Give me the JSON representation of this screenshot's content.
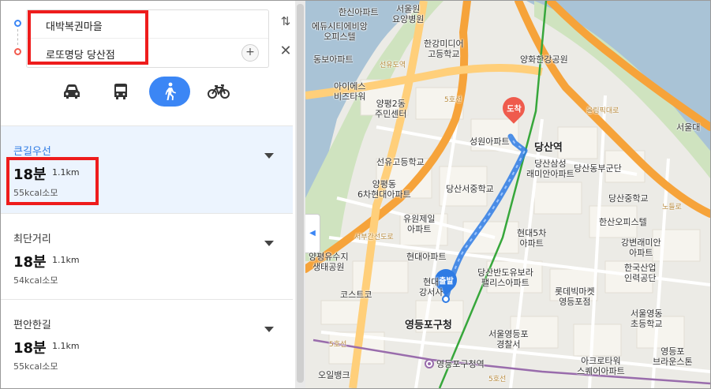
{
  "origin": {
    "text": "대박복권마을"
  },
  "destination": {
    "text": "로또명당 당산점"
  },
  "controls": {
    "add_stop": "+",
    "swap": "⇅",
    "close": "✕"
  },
  "modes": [
    {
      "name": "car",
      "icon": "car-icon"
    },
    {
      "name": "bus",
      "icon": "bus-icon"
    },
    {
      "name": "walk",
      "icon": "walk-icon",
      "selected": true
    },
    {
      "name": "bike",
      "icon": "bike-icon"
    }
  ],
  "routes": [
    {
      "type": "큰길우선",
      "time": "18분",
      "distance": "1.1km",
      "kcal": "55kcal소모",
      "active": true
    },
    {
      "type": "최단거리",
      "time": "18분",
      "distance": "1.1km",
      "kcal": "54kcal소모",
      "active": false
    },
    {
      "type": "편안한길",
      "time": "18분",
      "distance": "1.1km",
      "kcal": "55kcal소모",
      "active": false
    }
  ],
  "map": {
    "collapse": "◀",
    "start_pin": "출발",
    "end_pin": "도착",
    "labels": {
      "l1": "한신아파트",
      "l2": "서울원\n요양병원",
      "l3": "에듀시티에비앙\n오피스텔",
      "l4": "한강미디어\n고등학교",
      "l5": "동보아파트",
      "l6": "양화한강공원",
      "l7": "아이에스\n비즈타워",
      "l8": "양평2동\n주민센터",
      "l9": "성원아파트",
      "l10": "당산역",
      "l11": "당산삼성\n래미안아파트",
      "l12": "당산동부군단",
      "l13": "선유고등학교",
      "l14": "양평동\n6차현대아파트",
      "l15": "당산서중학교",
      "l16": "당산중학교",
      "l17": "유원제일\n아파트",
      "l18": "현대5차\n아파트",
      "l19": "한산오피스텔",
      "l20": "강변래미안\n아파트",
      "l21": "현대아파트",
      "l22": "양평유수지\n생태공원",
      "l23": "당산반도유보라\n팰리스아파트",
      "l24": "한국산업\n인력공단",
      "l25": "현대\n강서사",
      "l26": "코스트코",
      "l27": "롯데빅마켓\n영등포점",
      "l28": "서울영동\n초등학교",
      "l29": "영등포구청",
      "l30": "서울영등포\n경찰서",
      "l31": "영등포구청역",
      "l32": "오일뱅크",
      "l33": "아크로타워\n스퀘어아파트",
      "l34": "영등포\n브라운스톤",
      "l35": "서울대",
      "l36": "선유도역",
      "l37": "도착",
      "l38": "5호선",
      "l39": "올림픽대로",
      "l40": "5호선",
      "l41": "5호선",
      "l42": "서부간선도로",
      "l43": "노들로"
    }
  }
}
